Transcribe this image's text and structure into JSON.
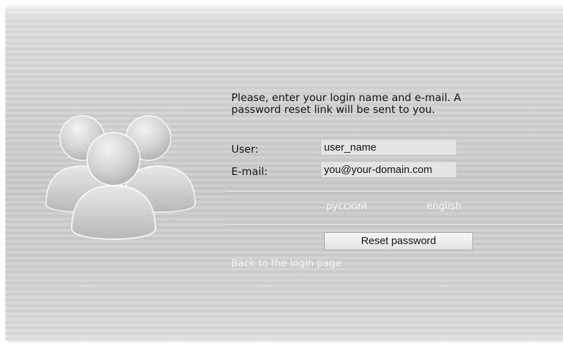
{
  "instructions": {
    "line1": "Please, enter your login name and e-mail. A",
    "line2": "password reset link will be sent to you."
  },
  "form": {
    "user_label": "User:",
    "user_value": "user_name",
    "email_label": "E-mail:",
    "email_value": "you@your-domain.com"
  },
  "languages": {
    "russian": "русский",
    "english": "english"
  },
  "actions": {
    "reset_label": "Reset password",
    "back_link": "Back to the login page"
  },
  "icons": {
    "users_graphic": "user-group-icon"
  }
}
